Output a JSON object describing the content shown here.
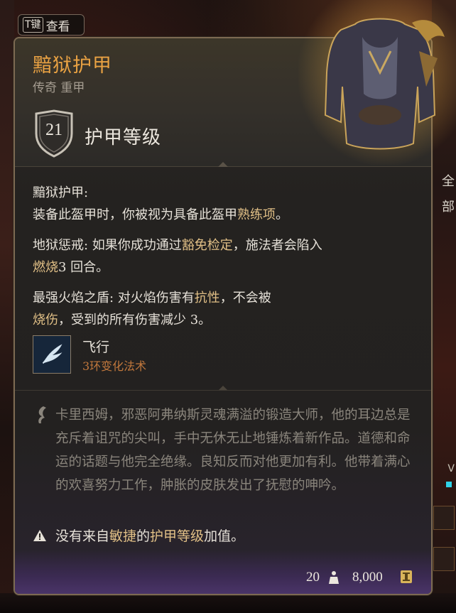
{
  "hotkey": {
    "key": "T键",
    "label": "查看"
  },
  "background": {
    "right_label": "全部",
    "right_letter": "V"
  },
  "item": {
    "name": "黯狱护甲",
    "subtitle": "传奇 重甲",
    "armor_class_value": "21",
    "armor_class_label": "护甲等级",
    "icon": "armor-chest-icon"
  },
  "properties": [
    {
      "title": "黯狱护甲:",
      "parts": [
        "装备此盔甲时，你被视为具备此盔甲",
        "熟练项",
        "。"
      ]
    },
    {
      "title_a": "地狱惩戒",
      "title_b": ": 如果你成功通过",
      "hl1": "豁免检定",
      "mid": "，施法者会陷入",
      "hl2": "燃烧",
      "end": "3 回合。"
    },
    {
      "title_a": "最强火焰之盾",
      "title_b": ": 对火焰伤害有",
      "hl1": "抗性",
      "mid": "，不会被",
      "hl2": "烧伤",
      "end": "，受到的所有伤害减少 3。"
    }
  ],
  "spell": {
    "name": "飞行",
    "level": "3环变化法术",
    "icon": "wing-feather-icon"
  },
  "lore": "卡里西姆，邪恶阿弗纳斯灵魂满溢的锻造大师，他的耳边总是充斥着诅咒的尖叫，手中无休无止地锤炼着新作品。道德和命运的话题与他完全绝缘。良知反而对他更加有利。他带着满心的欢喜努力工作，肿胀的皮肤发出了抚慰的呻吟。",
  "warning": {
    "icon": "warning-icon",
    "prefix": "没有来自",
    "hl1": "敏捷",
    "mid": "的",
    "hl2": "护甲等级",
    "end": "加值。"
  },
  "footer": {
    "weight": "20",
    "weight_icon": "weight-icon",
    "price": "8,000",
    "price_icon": "gold-coin-icon"
  },
  "colors": {
    "name": "#e9a243",
    "highlight": "#e0bf86",
    "spell_level": "#c0773c",
    "lore": "#8a857c",
    "border": "#7d6a52"
  }
}
